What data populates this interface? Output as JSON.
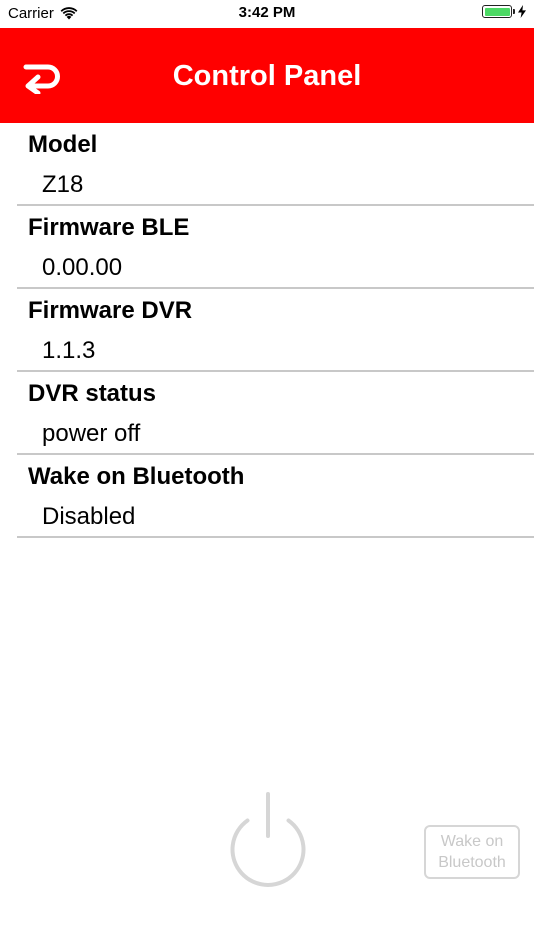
{
  "status_bar": {
    "carrier": "Carrier",
    "time": "3:42 PM",
    "battery_level": 1.0
  },
  "nav": {
    "title": "Control Panel",
    "background_color": "#ff0000",
    "back_icon": "return-arrow-icon"
  },
  "rows": [
    {
      "title": "Model",
      "value": "Z18"
    },
    {
      "title": "Firmware BLE",
      "value": "0.00.00"
    },
    {
      "title": "Firmware DVR",
      "value": "1.1.3"
    },
    {
      "title": "DVR status",
      "value": "power off"
    },
    {
      "title": "Wake on Bluetooth",
      "value": "Disabled"
    }
  ],
  "controls": {
    "power_icon": "power-icon",
    "wake_button_label": "Wake on Bluetooth",
    "disabled_color": "#c8c8c8"
  }
}
